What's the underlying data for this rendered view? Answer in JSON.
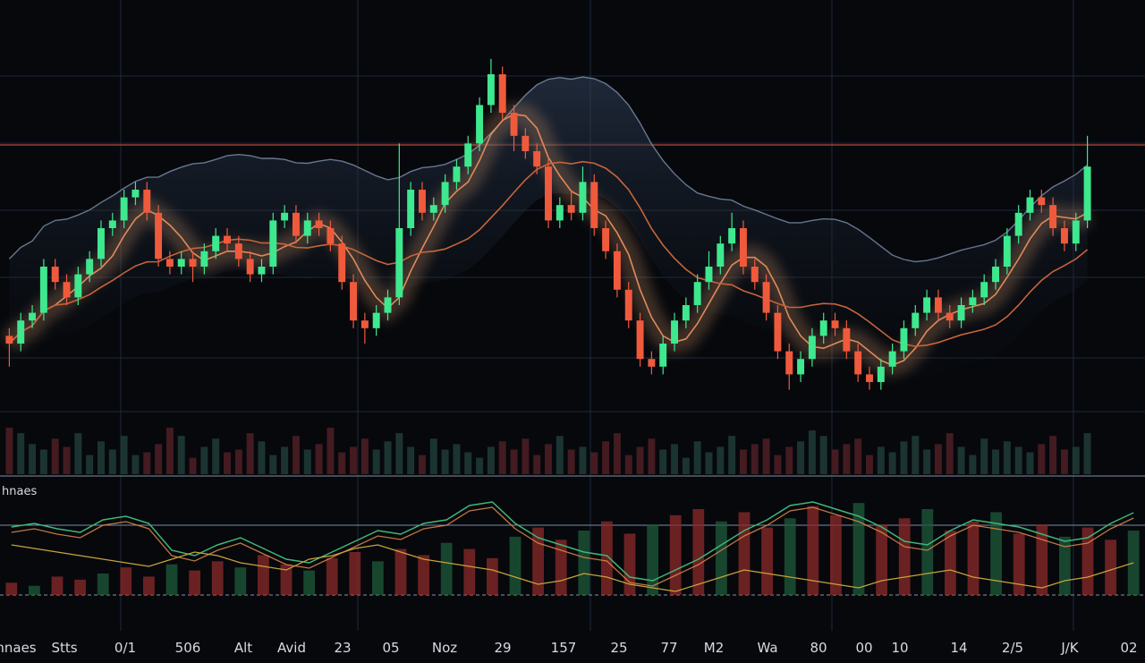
{
  "chart_data": [
    {
      "type": "candlestick",
      "title": "",
      "colors": {
        "up": "#3ee88e",
        "down": "#f05a3c",
        "ma_fast": "#e08a5a",
        "ma_slow": "#c8643a",
        "band": "#8fa3c0",
        "grid": "#1f2a3a",
        "level": "#b8483a"
      },
      "candles": [
        [
          52,
          50,
          54,
          44
        ],
        [
          50,
          56,
          58,
          48
        ],
        [
          56,
          58,
          60,
          54
        ],
        [
          58,
          70,
          72,
          56
        ],
        [
          70,
          66,
          72,
          64
        ],
        [
          66,
          62,
          68,
          60
        ],
        [
          62,
          68,
          70,
          60
        ],
        [
          68,
          72,
          74,
          66
        ],
        [
          72,
          80,
          82,
          70
        ],
        [
          80,
          82,
          84,
          78
        ],
        [
          82,
          88,
          90,
          80
        ],
        [
          88,
          90,
          92,
          86
        ],
        [
          90,
          84,
          92,
          82
        ],
        [
          84,
          72,
          86,
          70
        ],
        [
          72,
          70,
          74,
          68
        ],
        [
          70,
          72,
          74,
          68
        ],
        [
          72,
          70,
          74,
          66
        ],
        [
          70,
          74,
          76,
          68
        ],
        [
          74,
          78,
          80,
          72
        ],
        [
          78,
          76,
          80,
          74
        ],
        [
          76,
          72,
          78,
          70
        ],
        [
          72,
          68,
          74,
          66
        ],
        [
          68,
          70,
          72,
          66
        ],
        [
          70,
          82,
          84,
          68
        ],
        [
          82,
          84,
          86,
          80
        ],
        [
          84,
          78,
          86,
          76
        ],
        [
          78,
          82,
          84,
          76
        ],
        [
          82,
          80,
          84,
          78
        ],
        [
          80,
          76,
          82,
          74
        ],
        [
          76,
          66,
          78,
          64
        ],
        [
          66,
          56,
          68,
          54
        ],
        [
          56,
          54,
          58,
          50
        ],
        [
          54,
          58,
          60,
          52
        ],
        [
          58,
          62,
          64,
          56
        ],
        [
          62,
          80,
          102,
          60
        ],
        [
          80,
          90,
          92,
          78
        ],
        [
          90,
          84,
          92,
          82
        ],
        [
          84,
          86,
          88,
          82
        ],
        [
          86,
          92,
          94,
          84
        ],
        [
          92,
          96,
          98,
          90
        ],
        [
          96,
          102,
          104,
          94
        ],
        [
          102,
          112,
          114,
          100
        ],
        [
          112,
          120,
          124,
          110
        ],
        [
          120,
          110,
          122,
          108
        ],
        [
          110,
          104,
          112,
          100
        ],
        [
          104,
          100,
          106,
          98
        ],
        [
          100,
          96,
          102,
          94
        ],
        [
          96,
          82,
          98,
          80
        ],
        [
          82,
          86,
          88,
          80
        ],
        [
          86,
          84,
          90,
          82
        ],
        [
          84,
          92,
          96,
          82
        ],
        [
          92,
          80,
          94,
          78
        ],
        [
          80,
          74,
          82,
          72
        ],
        [
          74,
          64,
          76,
          62
        ],
        [
          64,
          56,
          66,
          54
        ],
        [
          56,
          46,
          58,
          44
        ],
        [
          46,
          44,
          48,
          42
        ],
        [
          44,
          50,
          52,
          42
        ],
        [
          50,
          56,
          58,
          48
        ],
        [
          56,
          60,
          62,
          54
        ],
        [
          60,
          66,
          68,
          58
        ],
        [
          66,
          70,
          74,
          64
        ],
        [
          70,
          76,
          78,
          68
        ],
        [
          76,
          80,
          84,
          74
        ],
        [
          80,
          70,
          82,
          68
        ],
        [
          70,
          66,
          72,
          64
        ],
        [
          66,
          58,
          68,
          56
        ],
        [
          58,
          48,
          60,
          46
        ],
        [
          48,
          42,
          50,
          38
        ],
        [
          42,
          46,
          48,
          40
        ],
        [
          46,
          52,
          54,
          44
        ],
        [
          52,
          56,
          58,
          50
        ],
        [
          56,
          54,
          58,
          52
        ],
        [
          54,
          48,
          56,
          46
        ],
        [
          48,
          42,
          50,
          40
        ],
        [
          42,
          40,
          44,
          38
        ],
        [
          40,
          44,
          46,
          38
        ],
        [
          44,
          48,
          50,
          42
        ],
        [
          48,
          54,
          56,
          46
        ],
        [
          54,
          58,
          60,
          52
        ],
        [
          58,
          62,
          64,
          56
        ],
        [
          62,
          58,
          64,
          56
        ],
        [
          58,
          56,
          60,
          54
        ],
        [
          56,
          60,
          62,
          54
        ],
        [
          60,
          62,
          64,
          58
        ],
        [
          62,
          66,
          68,
          60
        ],
        [
          66,
          70,
          72,
          64
        ],
        [
          70,
          78,
          80,
          68
        ],
        [
          78,
          84,
          86,
          76
        ],
        [
          84,
          88,
          90,
          82
        ],
        [
          88,
          86,
          90,
          84
        ],
        [
          86,
          80,
          88,
          78
        ],
        [
          80,
          76,
          82,
          74
        ],
        [
          76,
          82,
          84,
          74
        ],
        [
          82,
          96,
          104,
          80
        ]
      ],
      "volume": [
        34,
        30,
        22,
        18,
        26,
        20,
        30,
        14,
        24,
        18,
        28,
        14,
        16,
        22,
        34,
        28,
        12,
        20,
        26,
        16,
        18,
        30,
        24,
        14,
        20,
        28,
        18,
        22,
        34,
        16,
        20,
        26,
        18,
        24,
        30,
        20,
        14,
        26,
        18,
        22,
        16,
        12,
        20,
        24,
        18,
        26,
        14,
        22,
        28,
        18,
        20,
        16,
        24,
        30,
        14,
        20,
        26,
        18,
        22,
        12,
        24,
        16,
        20,
        28,
        18,
        22,
        26,
        14,
        20,
        24,
        32,
        28,
        18,
        22,
        26,
        14,
        20,
        16,
        24,
        28,
        18,
        22,
        30,
        20,
        14,
        26,
        18,
        24,
        20,
        16,
        22,
        28,
        18,
        20,
        30
      ],
      "oscillator": {
        "bars": [
          8,
          6,
          12,
          10,
          14,
          18,
          12,
          20,
          16,
          22,
          18,
          26,
          20,
          16,
          24,
          28,
          22,
          30,
          26,
          34,
          30,
          24,
          38,
          44,
          36,
          42,
          48,
          40,
          46,
          52,
          56,
          48,
          54,
          44,
          50,
          58,
          52,
          60,
          46,
          50,
          56,
          42,
          48,
          54,
          40,
          46,
          38,
          44,
          36,
          42
        ],
        "line_a": [
          58,
          60,
          57,
          55,
          62,
          64,
          60,
          45,
          42,
          48,
          52,
          46,
          40,
          38,
          44,
          50,
          56,
          54,
          60,
          62,
          70,
          72,
          60,
          52,
          48,
          44,
          42,
          30,
          28,
          34,
          40,
          48,
          56,
          62,
          70,
          72,
          68,
          64,
          58,
          50,
          48,
          56,
          62,
          60,
          58,
          54,
          50,
          52,
          60,
          66
        ],
        "line_b": [
          48,
          46,
          44,
          42,
          40,
          38,
          36,
          40,
          44,
          42,
          38,
          36,
          34,
          40,
          42,
          46,
          48,
          44,
          40,
          38,
          36,
          34,
          30,
          26,
          28,
          32,
          30,
          26,
          24,
          22,
          26,
          30,
          34,
          32,
          30,
          28,
          26,
          24,
          28,
          30,
          32,
          34,
          30,
          28,
          26,
          24,
          28,
          30,
          34,
          38
        ]
      },
      "panel_label": "hnaes",
      "x_tick_labels": [
        "hnaes",
        "Stts",
        "0/1",
        "506",
        "Alt",
        "Avid",
        "23",
        "05",
        "Noz",
        "29",
        "157",
        "25",
        "77",
        "M2",
        "Wa",
        "80",
        "00",
        "10",
        "14",
        "2/5",
        "J/K",
        "02"
      ]
    }
  ]
}
